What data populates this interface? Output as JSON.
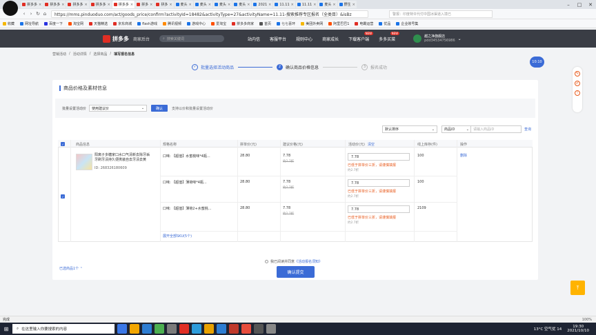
{
  "browser": {
    "tabs": [
      {
        "label": "拼多多",
        "color": "#e02e24",
        "active": false
      },
      {
        "label": "拼多多",
        "color": "#e02e24",
        "active": false
      },
      {
        "label": "拼多多",
        "color": "#e02e24",
        "active": false
      },
      {
        "label": "拼多多",
        "color": "#e02e24",
        "active": false
      },
      {
        "label": "拼多多",
        "color": "#e02e24",
        "active": true
      },
      {
        "label": "拼多",
        "color": "#e02e24",
        "active": false
      },
      {
        "label": "拼多",
        "color": "#e02e24",
        "active": false
      },
      {
        "label": "麦头",
        "color": "#1b74e8",
        "active": false
      },
      {
        "label": "麦头",
        "color": "#1b74e8",
        "active": false
      },
      {
        "label": "麦头",
        "color": "#1b74e8",
        "active": false
      },
      {
        "label": "麦头",
        "color": "#1b74e8",
        "active": false
      },
      {
        "label": "2021",
        "color": "#1b74e8",
        "active": false
      },
      {
        "label": "11.11",
        "color": "#1b74e8",
        "active": false
      },
      {
        "label": "11.11",
        "color": "#1b74e8",
        "active": false
      },
      {
        "label": "麦头",
        "color": "#1b74e8",
        "active": false
      },
      {
        "label": "野生",
        "color": "#1b74e8",
        "active": false
      }
    ],
    "url": "https://mms.pinduoduo.com/act/goods_price/confirm?activityId=18482&activityType=27&activityName=11.11-搜索推荐专区报名（全类目）&isBz",
    "notice_placeholder": "警报：印度特许代付中国冰渠道入境已",
    "bookmarks": [
      {
        "label": "收藏",
        "color": "#f5b700"
      },
      {
        "label": "网址导航",
        "color": "#1b74e8"
      },
      {
        "label": "百度一下",
        "color": "#2932e1"
      },
      {
        "label": "淘宝网",
        "color": "#ff5000"
      },
      {
        "label": "天猫精选",
        "color": "#e02e24"
      },
      {
        "label": "京东商城",
        "color": "#e02e24"
      },
      {
        "label": "flash游戏",
        "color": "#1b74e8"
      },
      {
        "label": "腾讯视频",
        "color": "#ff8a00"
      },
      {
        "label": "游戏中心",
        "color": "#1b74e8"
      },
      {
        "label": "爱淘宝",
        "color": "#ff5000"
      },
      {
        "label": "拼多多商家",
        "color": "#e02e24"
      },
      {
        "label": "首页",
        "color": "#555"
      },
      {
        "label": "七七喜环",
        "color": "#1b74e8"
      },
      {
        "label": "美团外卖网",
        "color": "#f5b700"
      },
      {
        "label": "阿里巴巴1",
        "color": "#ff5000"
      },
      {
        "label": "电霸运营",
        "color": "#e02e24"
      },
      {
        "label": "优品",
        "color": "#1b74e8"
      },
      {
        "label": "企业账号集",
        "color": "#1b74e8"
      }
    ]
  },
  "header": {
    "brand": "拼多多",
    "subtitle": "商家后台",
    "search_placeholder": "搜索关键词",
    "nav": [
      {
        "label": "站内信",
        "badge": ""
      },
      {
        "label": "客服平台",
        "badge": ""
      },
      {
        "label": "规则中心",
        "badge": ""
      },
      {
        "label": "商家成长",
        "badge": ""
      },
      {
        "label": "下载客户端",
        "badge": "NEW"
      },
      {
        "label": "多多买菜",
        "badge": "NEW"
      }
    ],
    "user_name": "越之净旗舰店",
    "user_id": "pdd34534756986"
  },
  "breadcrumb": [
    "营销活动",
    "活动详情",
    "选择商品",
    "填写报名信息"
  ],
  "steps": [
    {
      "num": "1",
      "label": "批量选择活动商品",
      "state": "done"
    },
    {
      "num": "2",
      "label": "确认商品价格信息",
      "state": "active"
    },
    {
      "num": "3",
      "label": "报名成功",
      "state": "todo"
    }
  ],
  "section_title": "商品价格及素材信息",
  "batch": {
    "label": "批量设置活动价",
    "select_value": "使用建议价",
    "button": "确认",
    "hint": "支持以价和批量设置活动价"
  },
  "filters": {
    "sort_value": "默认排序",
    "id_type": "商品ID",
    "id_placeholder": "请输入商品ID",
    "search": "查询"
  },
  "table": {
    "headers": [
      "商品信息",
      "规格名称",
      "拼单价(元)",
      "建议价格(元)",
      "活动价(元)",
      "清空",
      "线上库存(件)",
      "操作"
    ],
    "product": {
      "title": "阳离子多糖家口水口气清新去除牙垢 牙刷牙渍持久便携装自去牙渍去黄",
      "id": "ID: 268326180609",
      "delete": "删除"
    },
    "rows": [
      {
        "spec": "口味: 【超值】水蜜桃味*4瓶...",
        "price": "28.80",
        "suggest": "7.78",
        "suggest_sub": "约2.7折",
        "activity": "7.78",
        "warn": "已低于拼单价三折，请谨慎填报",
        "act_sub": "约2.7折",
        "stock": "100"
      },
      {
        "spec": "口味: 【超值】薄荷味*4瓶...",
        "price": "28.80",
        "suggest": "7.78",
        "suggest_sub": "约2.7折",
        "activity": "7.78",
        "warn": "已低于拼单价三折，请谨慎填报",
        "act_sub": "约2.7折",
        "stock": "100"
      },
      {
        "spec": "口味: 【超值】薄荷2+水蜜桃...",
        "price": "28.80",
        "suggest": "7.78",
        "suggest_sub": "约2.7折",
        "activity": "7.78",
        "warn": "已低于拼单价三折，请谨慎填报",
        "act_sub": "约2.7折",
        "stock": "2109"
      }
    ],
    "expand": "展开全部SKU(5个)"
  },
  "footer": {
    "agree_text": "我已阅读并同意",
    "agree_link": "《活动报名须知》",
    "selected": "已选商品1个",
    "submit": "确认提交"
  },
  "float_bubble": "10:10",
  "statusbar": {
    "left": "完成",
    "zoom": "100%"
  },
  "taskbar": {
    "search_placeholder": "在这里输入你要搜索的内容",
    "weather": "13°C 空气优 14",
    "time": "19:30",
    "date": "2021/10/10",
    "apps": [
      "#3b78e7",
      "#f2a600",
      "#2d7dd2",
      "#4caf50",
      "#7b7b7b",
      "#e02e24",
      "#2d9cdb",
      "#e8a100",
      "#2d7dd2",
      "#c0392b",
      "#e74c3c",
      "#555",
      "#888"
    ]
  }
}
